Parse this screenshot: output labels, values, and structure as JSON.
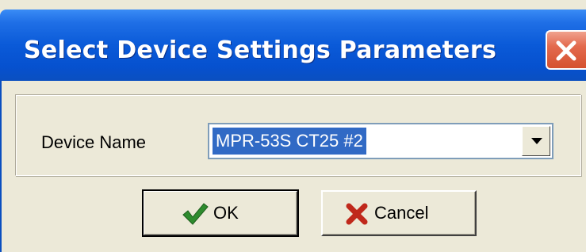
{
  "window": {
    "title": "Select Device Settings Parameters",
    "close_icon": "close-icon",
    "title_bar_color": "#0a5ad8",
    "close_button_color": "#d5512f"
  },
  "form": {
    "device_name_label": "Device Name",
    "device_name_value": "MPR-53S CT25 #2",
    "selection_color": "#316ac5"
  },
  "buttons": {
    "ok_label": "OK",
    "ok_icon": "checkmark-icon",
    "cancel_label": "Cancel",
    "cancel_icon": "red-x-icon"
  }
}
